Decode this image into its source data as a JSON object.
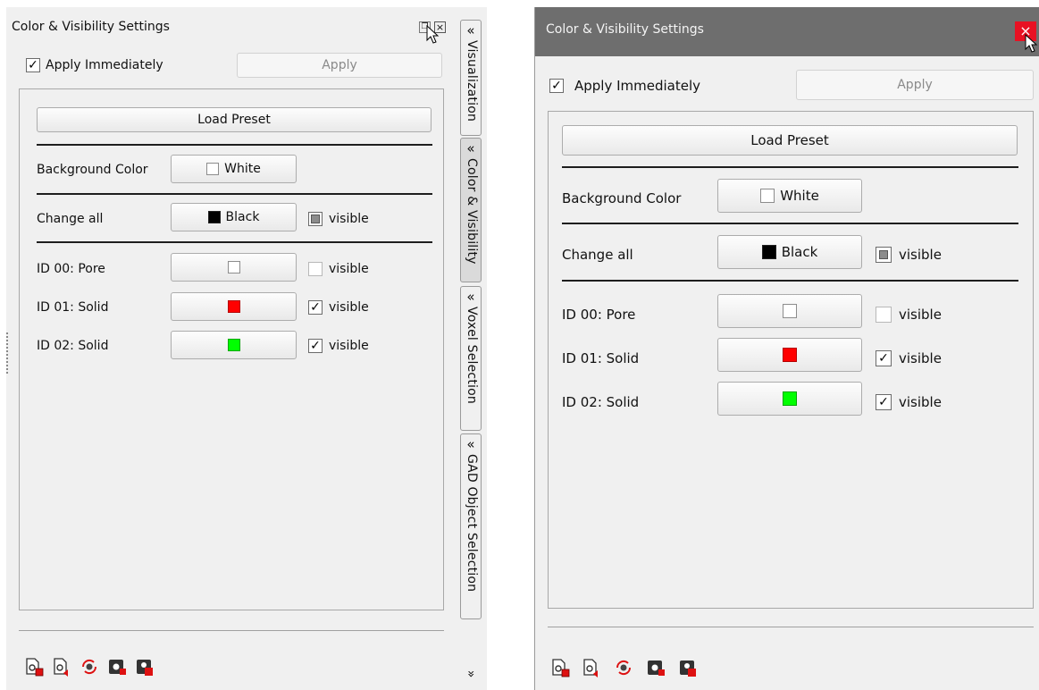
{
  "left": {
    "title": "Color & Visibility Settings",
    "apply_immediately_label": "Apply Immediately",
    "apply_label": "Apply",
    "load_preset_label": "Load Preset",
    "background_color_label": "Background Color",
    "background_color_value": "White",
    "change_all_label": "Change all",
    "change_all_value": "Black",
    "visible_label": "visible",
    "ids": [
      {
        "label": "ID 00: Pore",
        "color": "#ffffff",
        "visible": false
      },
      {
        "label": "ID 01: Solid",
        "color": "#ff0000",
        "visible": true
      },
      {
        "label": "ID 02: Solid",
        "color": "#00ff00",
        "visible": true
      }
    ],
    "side_tabs": [
      "Visualization",
      "Color & Visibility",
      "Voxel Selection",
      "GAD Object Selection"
    ],
    "side_tab_arrow": "«",
    "collapse_arrow": "»"
  },
  "right": {
    "title": "Color & Visibility Settings",
    "apply_immediately_label": "Apply Immediately",
    "apply_label": "Apply",
    "load_preset_label": "Load Preset",
    "background_color_label": "Background Color",
    "background_color_value": "White",
    "change_all_label": "Change all",
    "change_all_value": "Black",
    "visible_label": "visible",
    "ids": [
      {
        "label": "ID 00: Pore",
        "color": "#ffffff",
        "visible": false
      },
      {
        "label": "ID 01: Solid",
        "color": "#ff0000",
        "visible": true
      },
      {
        "label": "ID 02: Solid",
        "color": "#00ff00",
        "visible": true
      }
    ],
    "close_glyph": "×"
  },
  "colors": {
    "titlebar_dark": "#6e6e6e",
    "close_red": "#e81123"
  },
  "toolbar_icons": [
    "save-preset-icon",
    "load-preset-icon",
    "reset-icon",
    "export-icon",
    "import-icon"
  ]
}
